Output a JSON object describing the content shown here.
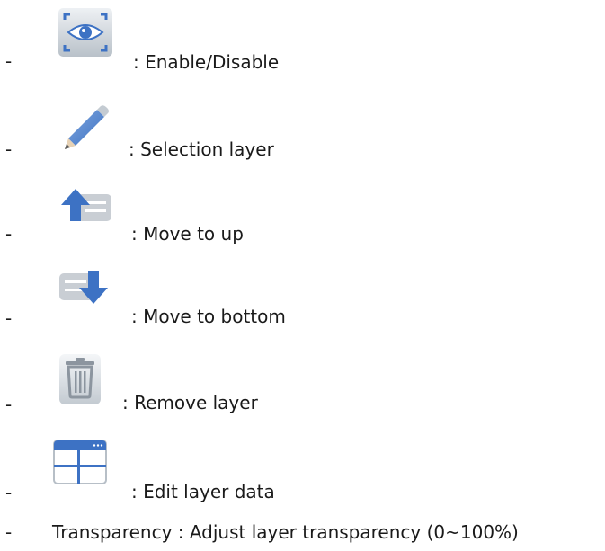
{
  "bullet": "-",
  "items": [
    {
      "icon": "eye-focus-icon",
      "text": ": Enable/Disable"
    },
    {
      "icon": "pencil-icon",
      "text": ": Selection layer"
    },
    {
      "icon": "move-up-arrow-icon",
      "text": ": Move to up"
    },
    {
      "icon": "move-down-arrow-icon",
      "text": ": Move to bottom"
    },
    {
      "icon": "trash-icon",
      "text": ": Remove layer"
    },
    {
      "icon": "table-grid-icon",
      "text": ": Edit layer data"
    }
  ],
  "transparency": "Transparency : Adjust layer transparency (0~100%)",
  "colors": {
    "icon_blue": "#3d72c4",
    "icon_gray": "#9aa3ad",
    "text": "#1a1a1a"
  }
}
